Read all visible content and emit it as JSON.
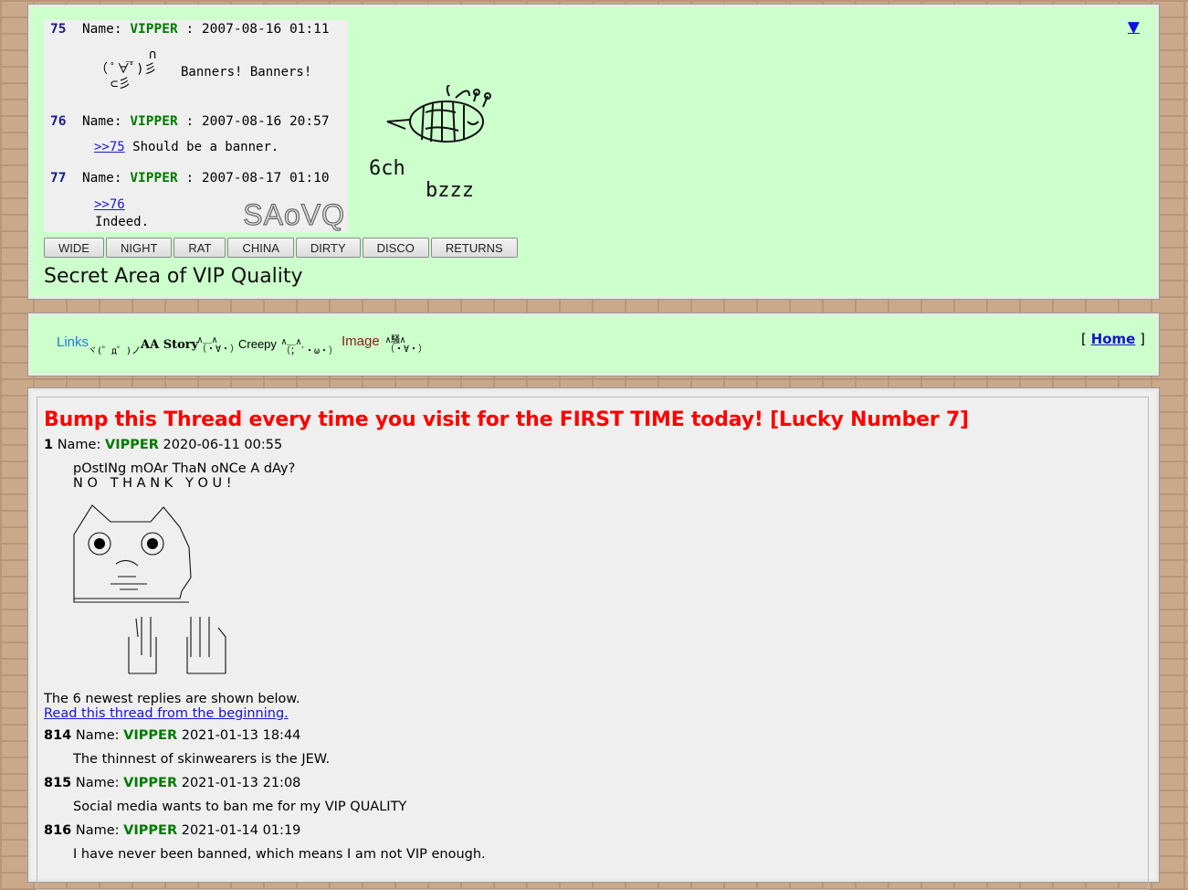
{
  "banner": {
    "bump_arrow": "▼",
    "posts": [
      {
        "num": "75",
        "name_label": "Name:",
        "name": "VIPPER",
        "sep": ":",
        "date": "2007-08-16 01:11",
        "text": "Banners! Banners!"
      },
      {
        "num": "76",
        "name_label": "Name:",
        "name": "VIPPER",
        "sep": ":",
        "date": "2007-08-16 20:57",
        "quote": ">>75",
        "text": "Should be a banner."
      },
      {
        "num": "77",
        "name_label": "Name:",
        "name": "VIPPER",
        "sep": ":",
        "date": "2007-08-17 01:10",
        "quote": ">>76",
        "text": "Indeed."
      }
    ],
    "logo_text": "SAoVQ",
    "bee_caption_left": "6ch",
    "bee_caption_right": "bzzz",
    "style_buttons": [
      "WIDE",
      "NIGHT",
      "RAT",
      "CHINA",
      "DIRTY",
      "DISCO",
      "RETURNS"
    ],
    "site_title": "Secret Area of VIP Quality"
  },
  "nav": {
    "links": [
      {
        "label": "Links",
        "aa": "ヾ(゜д゜)ノﾞ",
        "color": "#1e7ad8"
      },
      {
        "label": "AA Story",
        "aa": "∧＿∧\n（・∀・）",
        "color": "#000000"
      },
      {
        "label": "Creepy",
        "aa": "∧＿∧\n（；´・ω・）",
        "color": "#000000"
      },
      {
        "label": "Image",
        "aa": "∧騒∧\n（・∀・）",
        "color": "#8b1a1a"
      }
    ],
    "home_open": "[",
    "home_label": "Home",
    "home_close": "]"
  },
  "thread": {
    "title": "Bump this Thread every time you visit for the FIRST TIME today! [Lucky Number 7]",
    "op": {
      "num": "1",
      "name_label": "Name:",
      "name": "VIPPER",
      "date": "2020-06-11 00:55",
      "line1": "pOstINg mOAr ThaN oNCe A dAy?",
      "line2": "N O   T H A N K   Y O U !"
    },
    "note": "The 6 newest replies are shown below.",
    "read_link": "Read this thread from the beginning.",
    "replies": [
      {
        "num": "814",
        "name_label": "Name:",
        "name": "VIPPER",
        "date": "2021-01-13 18:44",
        "text": "The thinnest of skinwearers is the JEW."
      },
      {
        "num": "815",
        "name_label": "Name:",
        "name": "VIPPER",
        "date": "2021-01-13 21:08",
        "text": "Social media wants to ban me for my VIP QUALITY"
      },
      {
        "num": "816",
        "name_label": "Name:",
        "name": "VIPPER",
        "date": "2021-01-14 01:19",
        "text": "I have never been banned, which means I am not VIP enough."
      }
    ]
  },
  "colors": {
    "panel_green": "#ccffcc",
    "vipper_green": "#007a00",
    "title_red": "#ff0000",
    "link_blue": "#1515cc"
  }
}
